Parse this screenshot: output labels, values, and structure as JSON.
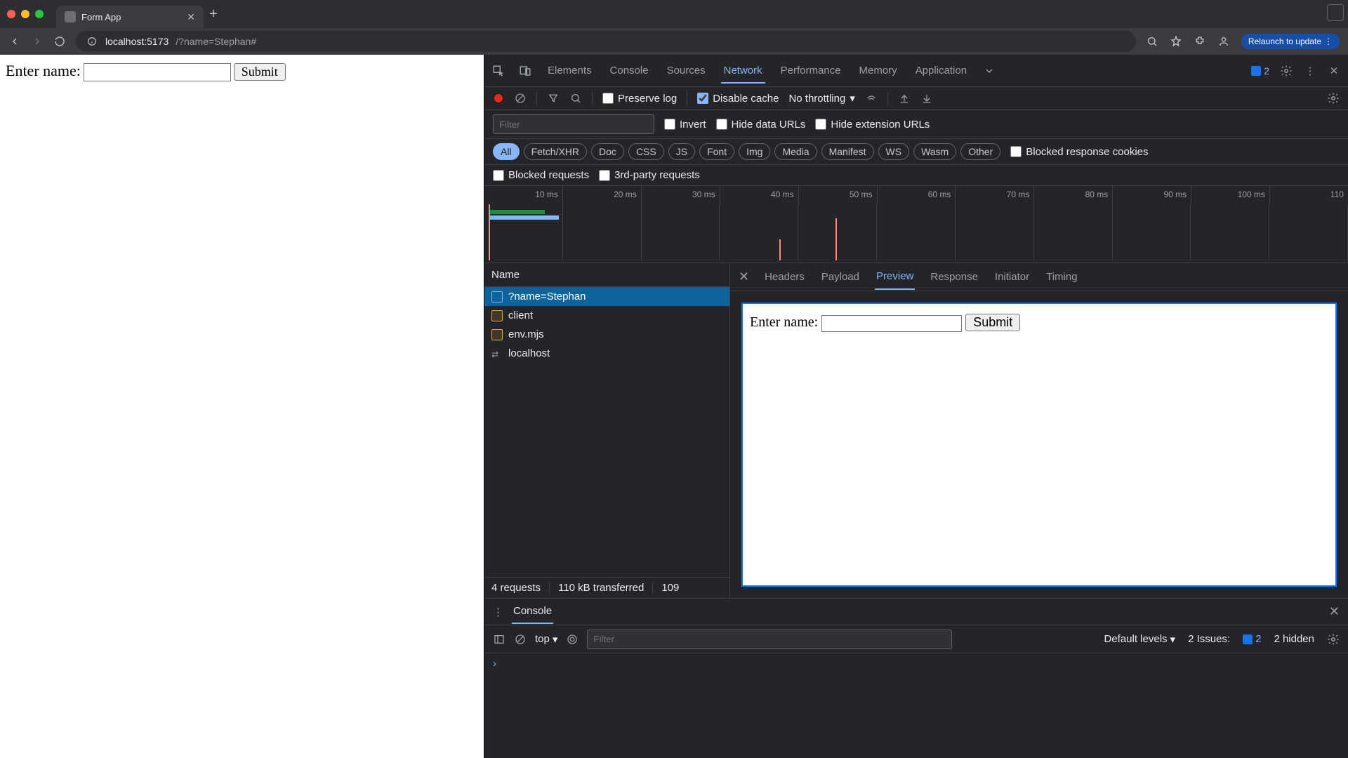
{
  "browser": {
    "tab_title": "Form App",
    "url_host": "localhost:5173",
    "url_path": "/?name=Stephan#",
    "relaunch": "Relaunch to update"
  },
  "page": {
    "label": "Enter name:",
    "submit": "Submit"
  },
  "devtools": {
    "tabs": [
      "Elements",
      "Console",
      "Sources",
      "Network",
      "Performance",
      "Memory",
      "Application"
    ],
    "active_tab": "Network",
    "issues_badge": "2"
  },
  "network": {
    "toolbar": {
      "preserve_log": "Preserve log",
      "disable_cache": "Disable cache",
      "throttle": "No throttling"
    },
    "filter_placeholder": "Filter",
    "filters2": {
      "invert": "Invert",
      "hide_data_urls": "Hide data URLs",
      "hide_ext_urls": "Hide extension URLs"
    },
    "types": [
      "All",
      "Fetch/XHR",
      "Doc",
      "CSS",
      "JS",
      "Font",
      "Img",
      "Media",
      "Manifest",
      "WS",
      "Wasm",
      "Other"
    ],
    "blocked_cookies": "Blocked response cookies",
    "filters3": {
      "blocked_requests": "Blocked requests",
      "third_party": "3rd-party requests"
    },
    "timeline_ticks": [
      "10 ms",
      "20 ms",
      "30 ms",
      "40 ms",
      "50 ms",
      "60 ms",
      "70 ms",
      "80 ms",
      "90 ms",
      "100 ms",
      "110"
    ],
    "name_header": "Name",
    "requests": [
      {
        "name": "?name=Stephan",
        "kind": "doc",
        "selected": true
      },
      {
        "name": "client",
        "kind": "js"
      },
      {
        "name": "env.mjs",
        "kind": "js"
      },
      {
        "name": "localhost",
        "kind": "ws"
      }
    ],
    "status": {
      "requests": "4 requests",
      "transferred": "110 kB transferred",
      "resources": "109"
    },
    "detail_tabs": [
      "Headers",
      "Payload",
      "Preview",
      "Response",
      "Initiator",
      "Timing"
    ],
    "detail_active": "Preview",
    "preview": {
      "label": "Enter name:",
      "submit": "Submit"
    }
  },
  "console": {
    "label": "Console",
    "context": "top",
    "filter_placeholder": "Filter",
    "levels": "Default levels",
    "issues_label": "2 Issues:",
    "issues_count": "2",
    "hidden": "2 hidden"
  }
}
